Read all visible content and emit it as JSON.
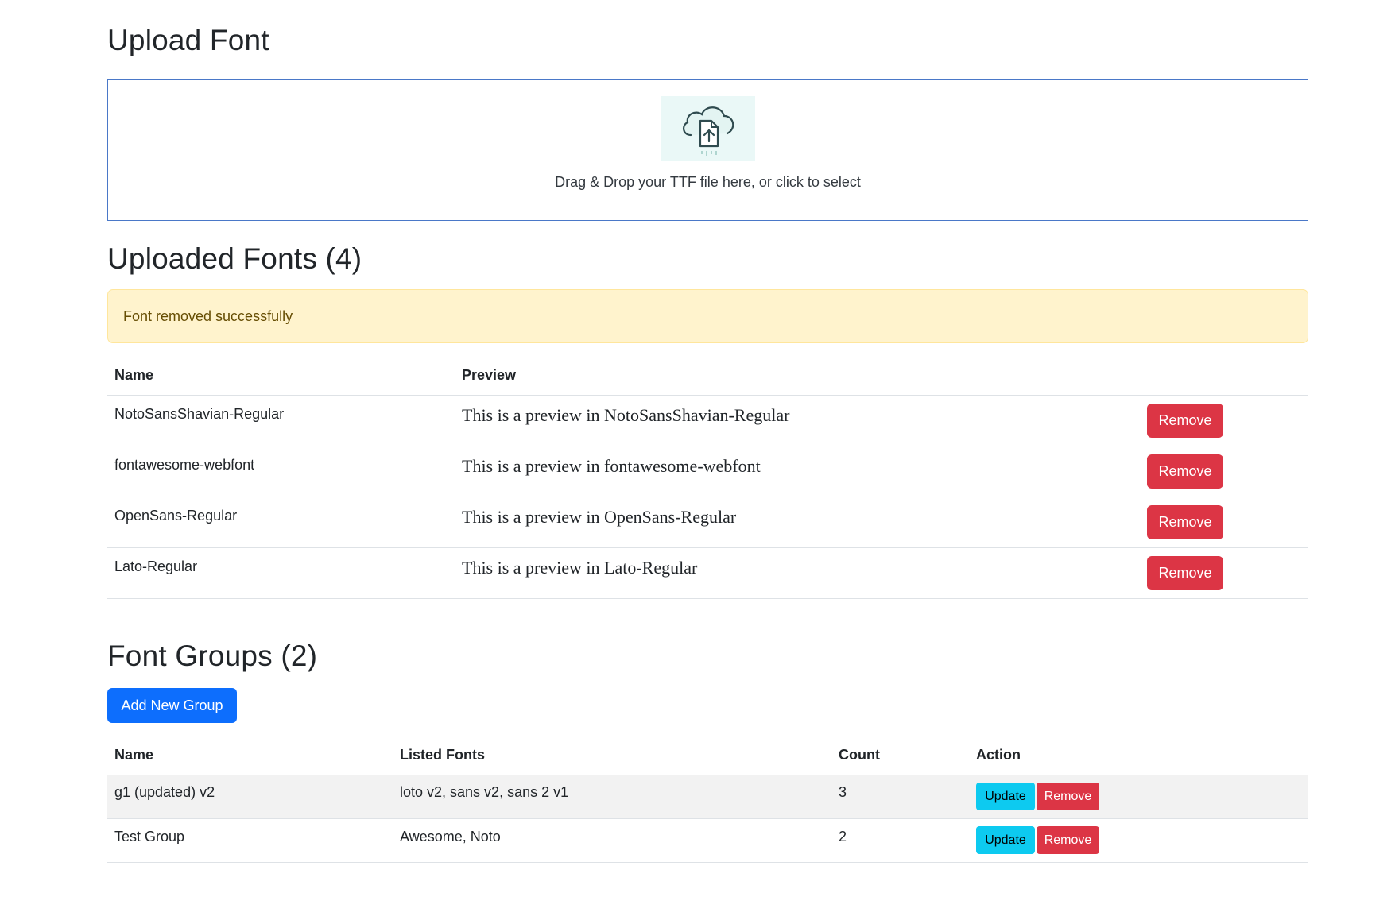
{
  "upload": {
    "title": "Upload Font",
    "dropzone_text": "Drag & Drop your TTF file here, or click to select",
    "icon": "cloud-upload-icon"
  },
  "fonts": {
    "title": "Uploaded Fonts (4)",
    "alert": "Font removed successfully",
    "headers": {
      "name": "Name",
      "preview": "Preview"
    },
    "rows": [
      {
        "name": "NotoSansShavian-Regular",
        "preview": "This is a preview in NotoSansShavian-Regular",
        "action": "Remove"
      },
      {
        "name": "fontawesome-webfont",
        "preview": "This is a preview in fontawesome-webfont",
        "action": "Remove"
      },
      {
        "name": "OpenSans-Regular",
        "preview": "This is a preview in OpenSans-Regular",
        "action": "Remove"
      },
      {
        "name": "Lato-Regular",
        "preview": "This is a preview in Lato-Regular",
        "action": "Remove"
      }
    ]
  },
  "groups": {
    "title": "Font Groups (2)",
    "add_button": "Add New Group",
    "headers": {
      "name": "Name",
      "listed": "Listed Fonts",
      "count": "Count",
      "action": "Action"
    },
    "rows": [
      {
        "name": "g1 (updated) v2",
        "listed": "loto v2, sans v2, sans 2 v1",
        "count": "3",
        "update": "Update",
        "remove": "Remove"
      },
      {
        "name": "Test Group",
        "listed": "Awesome, Noto",
        "count": "2",
        "update": "Update",
        "remove": "Remove"
      }
    ]
  },
  "colors": {
    "danger": "#dc3545",
    "info": "#0dcaf0",
    "primary": "#0d6efd",
    "alert_bg": "#fff3cd",
    "dropzone_border": "#4a78c8"
  }
}
